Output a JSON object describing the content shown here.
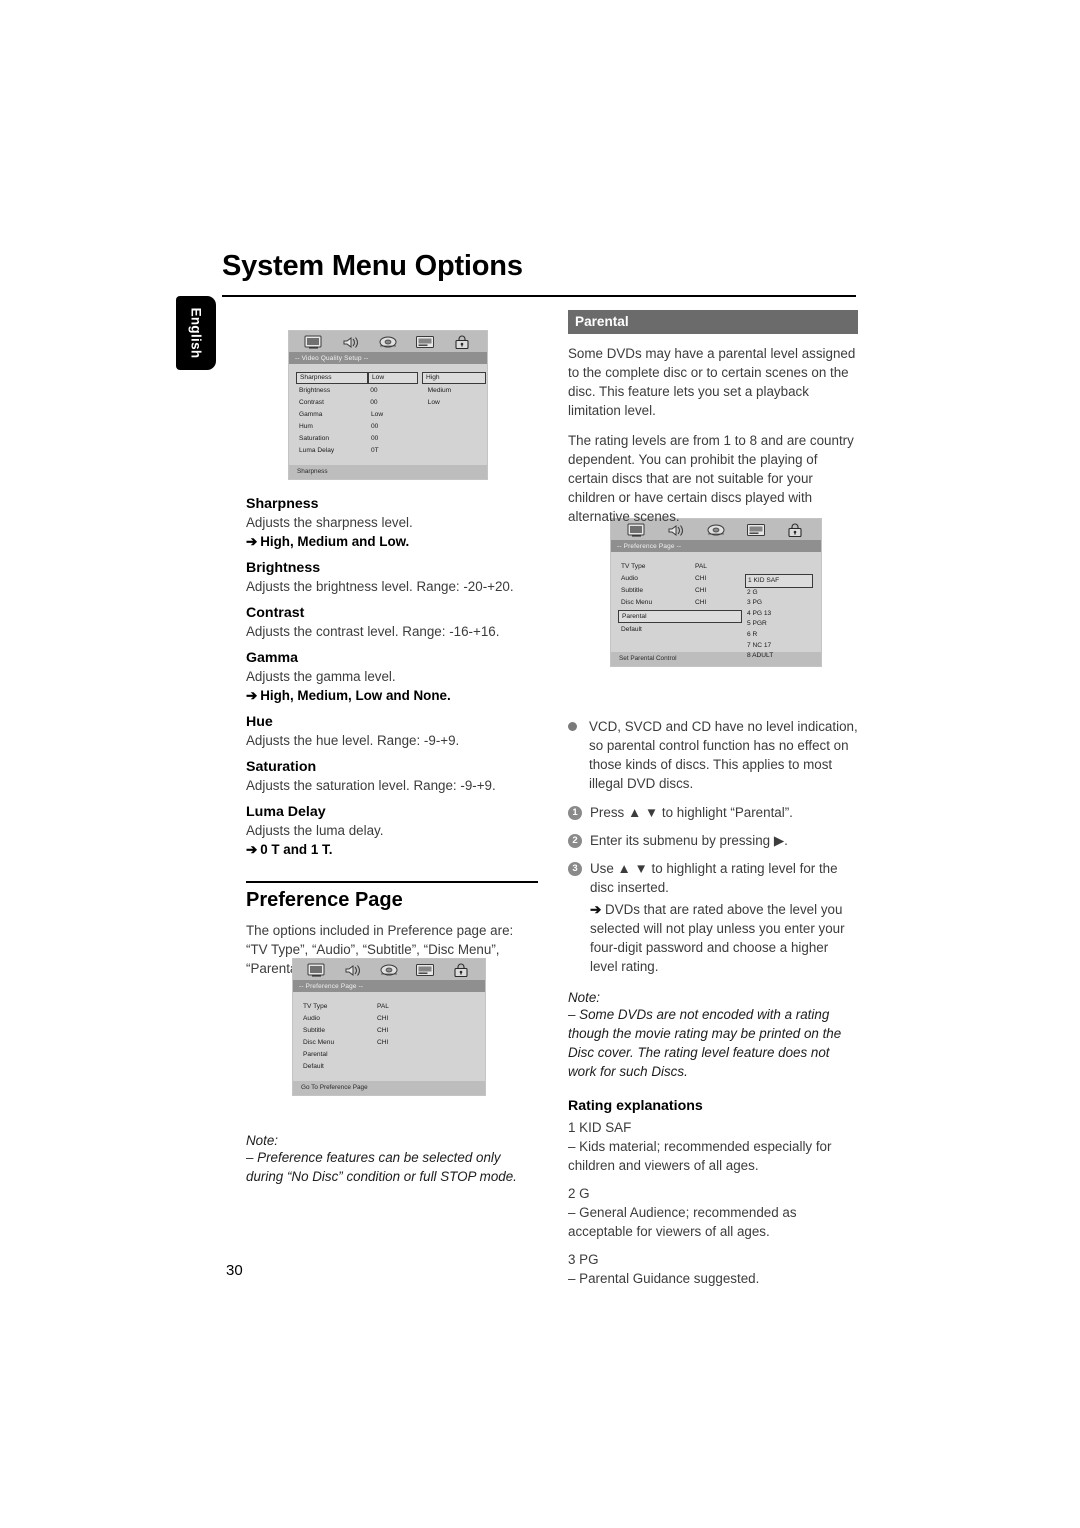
{
  "page": {
    "title": "System Menu Options",
    "language_tab": "English",
    "page_number": "30"
  },
  "osd_video": {
    "title": "-- Video Quality Setup --",
    "footer": "Sharpness",
    "icons": [
      "tv-icon",
      "speaker-icon",
      "video-icon",
      "subtitle-icon",
      "lock-icon"
    ],
    "rows": [
      {
        "label": "Sharpness",
        "value": "Low",
        "option": "High",
        "highlight": true
      },
      {
        "label": "Brightness",
        "value": "00",
        "option": "Medium",
        "highlight": false
      },
      {
        "label": "Contrast",
        "value": "00",
        "option": "Low",
        "highlight": false
      },
      {
        "label": "Gamma",
        "value": "Low",
        "option": "",
        "highlight": false
      },
      {
        "label": "Hum",
        "value": "00",
        "option": "",
        "highlight": false
      },
      {
        "label": "Saturation",
        "value": "00",
        "option": "",
        "highlight": false
      },
      {
        "label": "Luma Delay",
        "value": "0T",
        "option": "",
        "highlight": false
      }
    ]
  },
  "osd_preference": {
    "title": "-- Preference Page --",
    "footer": "Go To Preference Page",
    "icons": [
      "tv-icon",
      "speaker-icon",
      "video-icon",
      "subtitle-icon",
      "lock-icon"
    ],
    "rows": [
      {
        "label": "TV Type",
        "value": "PAL"
      },
      {
        "label": "Audio",
        "value": "CHI"
      },
      {
        "label": "Subtitle",
        "value": "CHI"
      },
      {
        "label": "Disc Menu",
        "value": "CHI"
      },
      {
        "label": "Parental",
        "value": ""
      },
      {
        "label": "Default",
        "value": ""
      }
    ]
  },
  "osd_parental": {
    "title": "-- Preference Page --",
    "footer": "Set Parental Control",
    "icons": [
      "tv-icon",
      "speaker-icon",
      "video-icon",
      "subtitle-icon",
      "lock-icon"
    ],
    "rows": [
      {
        "label": "TV Type",
        "value": "PAL",
        "highlight": false
      },
      {
        "label": "Audio",
        "value": "CHI",
        "highlight": false
      },
      {
        "label": "Subtitle",
        "value": "CHI",
        "highlight": false
      },
      {
        "label": "Disc Menu",
        "value": "CHI",
        "highlight": false
      },
      {
        "label": "Parental",
        "value": "",
        "highlight": true
      },
      {
        "label": "Default",
        "value": "",
        "highlight": false
      }
    ],
    "levels": [
      "1 KID SAF",
      "2 G",
      "3 PG",
      "4 PG 13",
      "5 PGR",
      "6 R",
      "7 NC 17",
      "8 ADULT"
    ]
  },
  "left_column": {
    "items": [
      {
        "head": "Sharpness",
        "desc": "Adjusts the sharpness level.",
        "options_prefix": "",
        "options": "High, Medium and Low."
      },
      {
        "head": "Brightness",
        "desc": "Adjusts the brightness level. Range: -20-+20.",
        "options": ""
      },
      {
        "head": "Contrast",
        "desc": "Adjusts the contrast level. Range: -16-+16.",
        "options": ""
      },
      {
        "head": "Gamma",
        "desc": "Adjusts the gamma level.",
        "options": "High, Medium, Low and None."
      },
      {
        "head": "Hue",
        "desc": "Adjusts the hue level. Range: -9-+9.",
        "options": ""
      },
      {
        "head": "Saturation",
        "desc": "Adjusts the saturation level. Range: -9-+9.",
        "options": ""
      },
      {
        "head": "Luma Delay",
        "desc": "Adjusts the luma delay.",
        "options": "0 T and 1 T."
      }
    ],
    "preference_heading": "Preference Page",
    "preference_intro": "The options included in Preference page are: “TV Type”, “Audio”, “Subtitle”, “Disc Menu”, “Parental” and “Default”.",
    "note_title": "Note:",
    "note_body": "–  Preference features can be selected only during “No Disc” condition or full STOP mode."
  },
  "right_column": {
    "section_label": "Parental",
    "paragraph_1": "Some DVDs may have a parental level assigned to the complete disc or to certain scenes on the disc. This feature lets you set a playback limitation level.",
    "paragraph_2": "The rating levels are from 1 to 8 and are country dependent. You can prohibit the playing of certain discs that are not suitable for your children or have certain discs played with alternative scenes.",
    "bullet": "VCD, SVCD and CD have no level indication, so parental control function has no effect on those kinds of discs. This applies to most illegal DVD discs.",
    "steps": [
      {
        "num": "1",
        "text": "Press ▲ ▼  to highlight “Parental”."
      },
      {
        "num": "2",
        "text": "Enter its submenu by pressing ▶."
      },
      {
        "num": "3",
        "text": "Use ▲ ▼  to highlight a rating level for the disc inserted."
      }
    ],
    "step3_sub": "DVDs that are rated above the level you selected will not play unless you enter your four-digit password and choose a higher level rating.",
    "note_title": "Note:",
    "note_body": "–  Some DVDs are not encoded with a rating though the movie rating may be printed on the Disc cover. The rating level feature does not work for such Discs.",
    "rating_heading": "Rating explanations",
    "ratings": [
      {
        "code": "1 KID SAF",
        "desc": "–   Kids material; recommended especially for children and viewers of all ages."
      },
      {
        "code": "2 G",
        "desc": "–   General Audience; recommended as acceptable for viewers of all ages."
      },
      {
        "code": "3 PG",
        "desc": "–  Parental Guidance suggested."
      }
    ]
  },
  "colors": {
    "section_bar": "#6b6b6b",
    "osd_bg": "#d3d3d3",
    "osd_titlebar": "#8f8f8f",
    "osd_iconbar": "#bdbdbd",
    "body_text": "#3c3c3c"
  }
}
